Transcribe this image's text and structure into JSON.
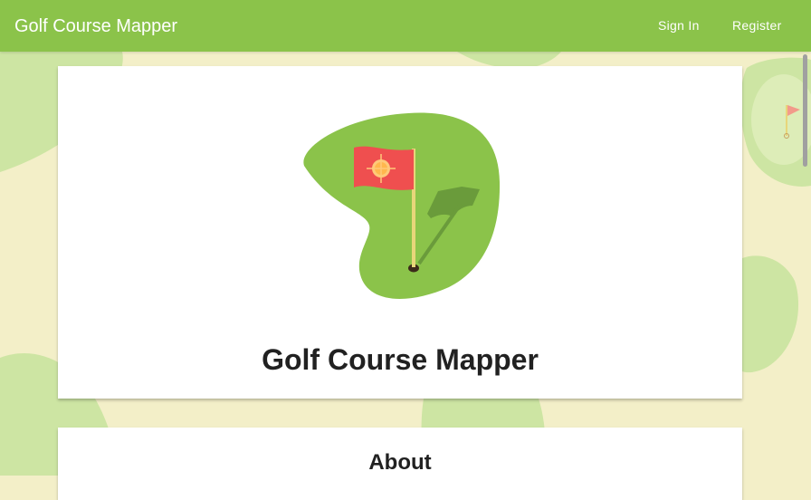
{
  "header": {
    "app_title": "Golf Course Mapper",
    "nav": {
      "sign_in": "Sign In",
      "register": "Register"
    }
  },
  "hero": {
    "title": "Golf Course Mapper"
  },
  "about": {
    "title": "About"
  },
  "colors": {
    "appbar": "#8bc34a",
    "background": "#f3efc8",
    "fairway_light": "#cde5a3",
    "green": "#8bc34a",
    "flag": "#ef4f4f",
    "flag_target": "#ffc97a",
    "pole": "#e8d67a"
  },
  "icons": [
    "golf-green-flag-logo",
    "background-flag-icon"
  ]
}
